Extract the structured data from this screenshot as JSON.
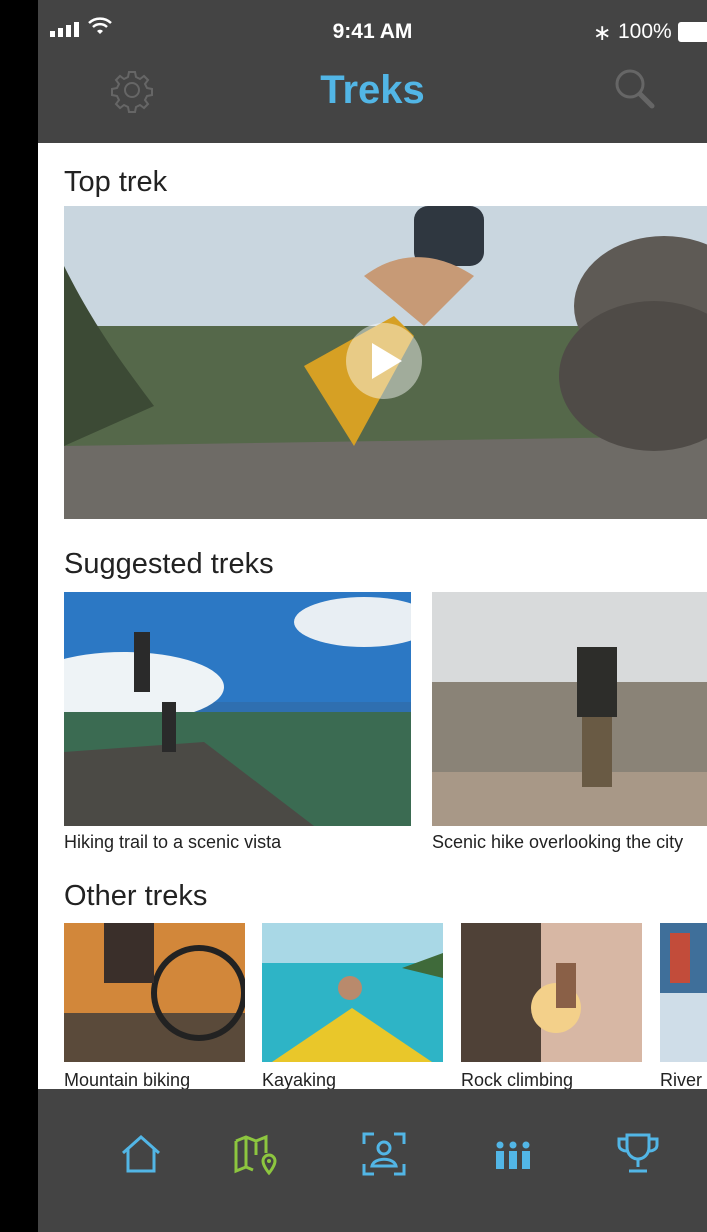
{
  "status_bar": {
    "time": "9:41 AM",
    "battery": "100%",
    "bluetooth_icon": "bluetooth-icon"
  },
  "nav": {
    "title": "Treks",
    "left_icon": "gear-icon",
    "right_icon": "search-icon"
  },
  "sections": {
    "top": "Top trek",
    "suggested": "Suggested treks",
    "other": "Other treks"
  },
  "suggested": [
    {
      "caption": "Hiking trail to a scenic vista"
    },
    {
      "caption": "Scenic hike overlooking the city"
    }
  ],
  "other": [
    {
      "caption": "Mountain biking"
    },
    {
      "caption": "Kayaking"
    },
    {
      "caption": "Rock climbing"
    },
    {
      "caption": "River"
    }
  ],
  "tabbar": {
    "items": [
      "home-icon",
      "map-icon",
      "profile-scan-icon",
      "group-icon",
      "trophy-icon"
    ],
    "colors": {
      "home": "#52b6e6",
      "map": "#8dc63f",
      "profile": "#52b6e6",
      "group": "#52b6e6",
      "trophy": "#52b6e6"
    }
  },
  "colors": {
    "accent": "#52b6e6",
    "bar_bg": "#444444",
    "map_tab": "#8dc63f"
  }
}
